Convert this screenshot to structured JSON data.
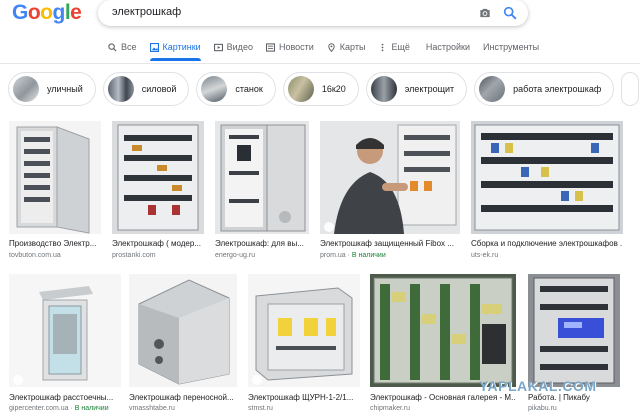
{
  "logo": [
    "G",
    "o",
    "o",
    "g",
    "l",
    "e"
  ],
  "logo_colors": [
    "#4285f4",
    "#ea4335",
    "#fbbc05",
    "#4285f4",
    "#34a853",
    "#ea4335"
  ],
  "search": {
    "query": "электрошкаф"
  },
  "tabs": [
    {
      "label": "Все",
      "icon": "search-icon"
    },
    {
      "label": "Картинки",
      "icon": "image-icon",
      "active": true
    },
    {
      "label": "Видео",
      "icon": "video-icon"
    },
    {
      "label": "Новости",
      "icon": "news-icon"
    },
    {
      "label": "Карты",
      "icon": "map-pin-icon"
    },
    {
      "label": "Ещё",
      "icon": "more-icon"
    },
    {
      "label": "Настройки"
    },
    {
      "label": "Инструменты"
    }
  ],
  "chips": [
    "уличный",
    "силовой",
    "станок",
    "16к20",
    "электрощит",
    "работа электрошкаф"
  ],
  "results_row1": [
    {
      "caption": "Производство Электр...",
      "source": "tovbuton.com.ua"
    },
    {
      "caption": "Электрошкаф ( модер...",
      "source": "prostanki.com"
    },
    {
      "caption": "Электрошкаф: для вы...",
      "source": "energo-ug.ru"
    },
    {
      "caption": "Электрошкаф защищенный Fibox ...",
      "source": "prom.ua",
      "stock": "В наличии"
    },
    {
      "caption": "Сборка и подключение электрошкафов ...",
      "source": "uts-ek.ru"
    }
  ],
  "results_row2": [
    {
      "caption": "Электрошкаф расстоечны...",
      "source": "gipercenter.com.ua",
      "stock": "В наличии"
    },
    {
      "caption": "Электрошкаф переносной...",
      "source": "vmasshtabe.ru"
    },
    {
      "caption": "Электрошкаф ЩУРН-1-2/1...",
      "source": "stmst.ru"
    },
    {
      "caption": "Электрошкаф - Основная галерея - М...",
      "source": "chipmaker.ru"
    },
    {
      "caption": "Работа. | Пикабу",
      "source": "pikabu.ru"
    }
  ],
  "watermark": "YAPLAKAL.COM",
  "colors": {
    "accent": "#1a73e8",
    "stock": "#188038",
    "muted": "#70757a"
  }
}
